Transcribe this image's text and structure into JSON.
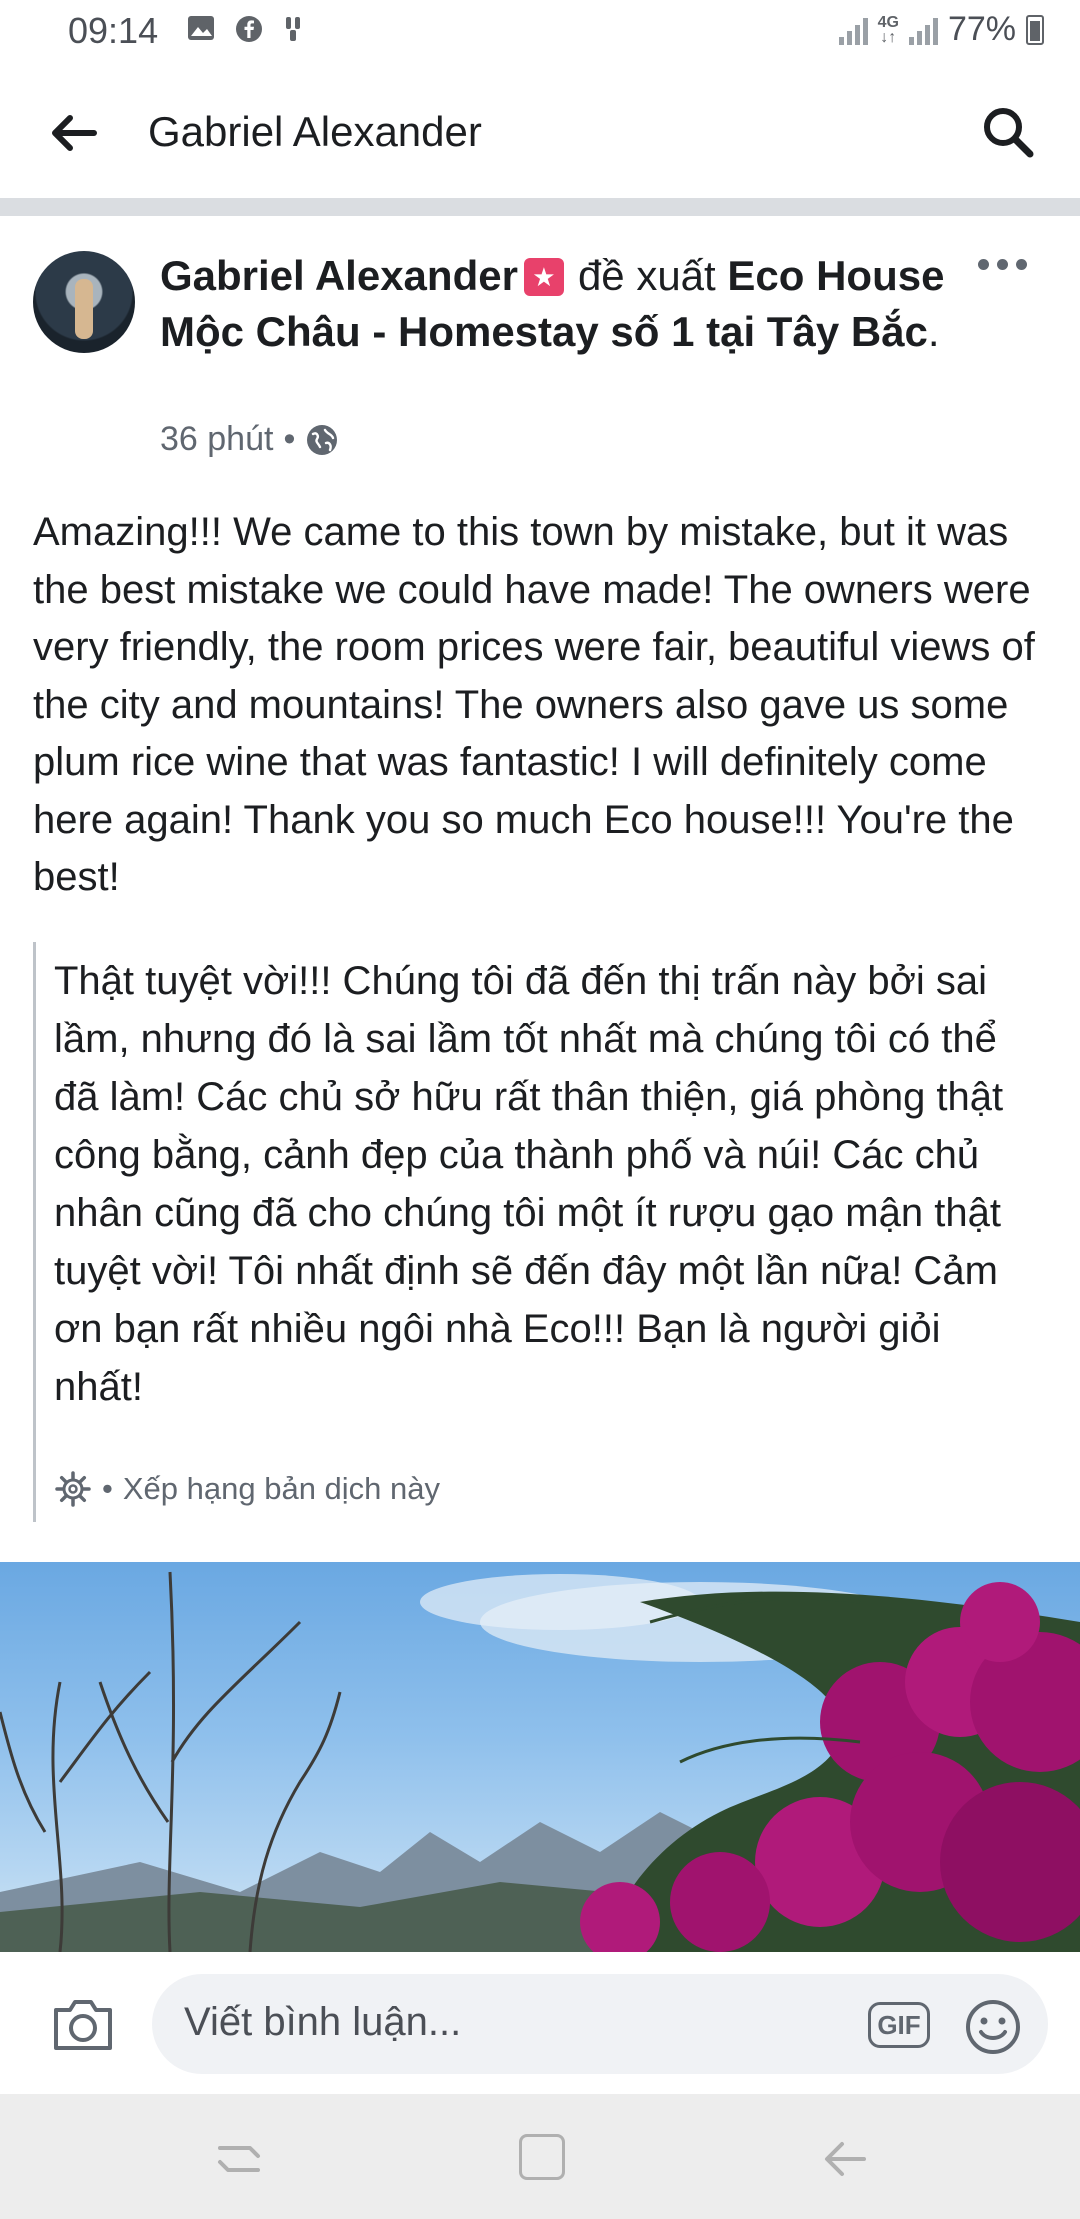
{
  "status_bar": {
    "time": "09:14",
    "battery": "77%",
    "network": "4G"
  },
  "app_bar": {
    "title": "Gabriel Alexander"
  },
  "post": {
    "author": "Gabriel Alexander",
    "verb": "đề xuất",
    "page_name": "Eco House Mộc Châu - Homestay số 1 tại Tây Bắc",
    "page_suffix": ".",
    "time": "36 phút",
    "separator": "•",
    "body": "Amazing!!! We came to this town by mistake, but it was the best mistake we could have made! The owners were very friendly, the room prices were fair, beautiful views of the city and mountains! The owners also gave us some plum rice wine that was fantastic! I will definitely come here again! Thank you so much Eco house!!! You're the best!",
    "translation": "Thật tuyệt vời!!! Chúng tôi đã đến thị trấn này bởi sai lầm, nhưng đó là sai lầm tốt nhất mà chúng tôi có thể đã làm! Các chủ sở hữu rất thân thiện, giá phòng thật công bằng, cảnh đẹp của thành phố và núi! Các chủ nhân cũng đã cho chúng tôi một ít rượu gạo mận thật tuyệt vời! Tôi nhất định sẽ đến đây một lần nữa! Cảm ơn bạn rất nhiều ngôi nhà Eco!!! Bạn là người giỏi nhất!",
    "rate_translation": "Xếp hạng bản dịch này"
  },
  "comment_bar": {
    "placeholder": "Viết bình luận...",
    "gif_label": "GIF"
  },
  "colors": {
    "badge": "#e8416b",
    "divider": "#dadde1",
    "secondary_text": "#606770",
    "flowers": "#a0136e"
  }
}
